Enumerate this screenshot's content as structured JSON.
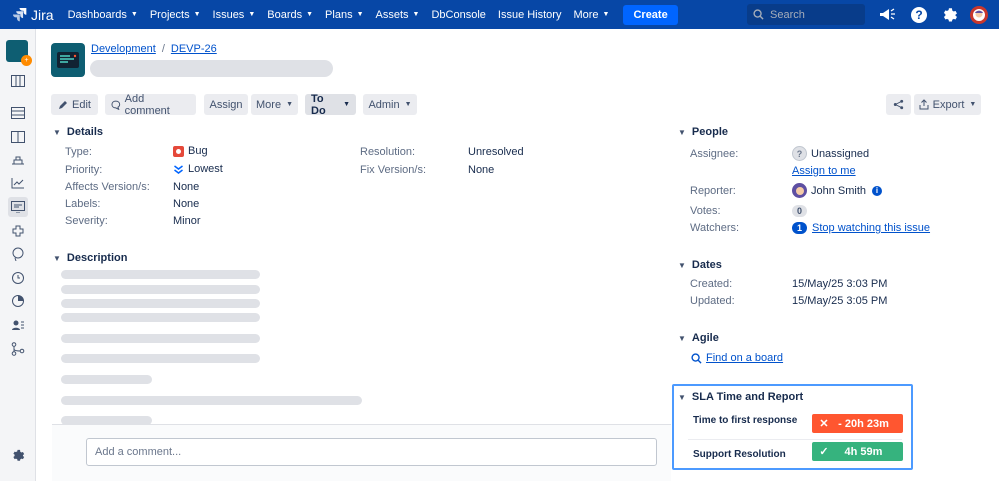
{
  "topnav": {
    "logo_text": "Jira",
    "items": [
      {
        "label": "Dashboards",
        "has_menu": true
      },
      {
        "label": "Projects",
        "has_menu": true
      },
      {
        "label": "Issues",
        "has_menu": true
      },
      {
        "label": "Boards",
        "has_menu": true
      },
      {
        "label": "Plans",
        "has_menu": true
      },
      {
        "label": "Assets",
        "has_menu": true
      },
      {
        "label": "DbConsole",
        "has_menu": false
      },
      {
        "label": "Issue History",
        "has_menu": false
      },
      {
        "label": "More",
        "has_menu": true
      }
    ],
    "create_label": "Create",
    "search_placeholder": "Search"
  },
  "breadcrumb": {
    "project": "Development",
    "issue_key": "DEVP-26"
  },
  "toolbar": {
    "edit": "Edit",
    "add_comment": "Add comment",
    "assign": "Assign",
    "more": "More",
    "status": "To Do",
    "admin": "Admin",
    "export": "Export"
  },
  "details": {
    "heading": "Details",
    "type_label": "Type:",
    "type_value": "Bug",
    "priority_label": "Priority:",
    "priority_value": "Lowest",
    "affects_label": "Affects Version/s:",
    "affects_value": "None",
    "labels_label": "Labels:",
    "labels_value": "None",
    "severity_label": "Severity:",
    "severity_value": "Minor",
    "resolution_label": "Resolution:",
    "resolution_value": "Unresolved",
    "fix_label": "Fix Version/s:",
    "fix_value": "None"
  },
  "description": {
    "heading": "Description"
  },
  "comment": {
    "placeholder": "Add a comment..."
  },
  "people": {
    "heading": "People",
    "assignee_label": "Assignee:",
    "assignee_value": "Unassigned",
    "assign_to_me": "Assign to me",
    "reporter_label": "Reporter:",
    "reporter_value": "John Smith",
    "votes_label": "Votes:",
    "votes_value": "0",
    "watchers_label": "Watchers:",
    "watchers_count": "1",
    "watchers_link": "Stop watching this issue"
  },
  "dates": {
    "heading": "Dates",
    "created_label": "Created:",
    "created_value": "15/May/25 3:03 PM",
    "updated_label": "Updated:",
    "updated_value": "15/May/25 3:05 PM"
  },
  "agile": {
    "heading": "Agile",
    "find_board": "Find on a board"
  },
  "sla": {
    "heading": "SLA Time and Report",
    "rows": [
      {
        "label": "Time to first response",
        "value": "- 20h 23m",
        "status": "breached",
        "color": "#ff5630"
      },
      {
        "label": "Support Resolution",
        "value": "4h 59m",
        "status": "ok",
        "color": "#36b37e"
      }
    ]
  },
  "colors": {
    "nav": "#0747a6",
    "link": "#0052cc",
    "bug": "#e5493a",
    "sla_border": "#4c9aff"
  }
}
